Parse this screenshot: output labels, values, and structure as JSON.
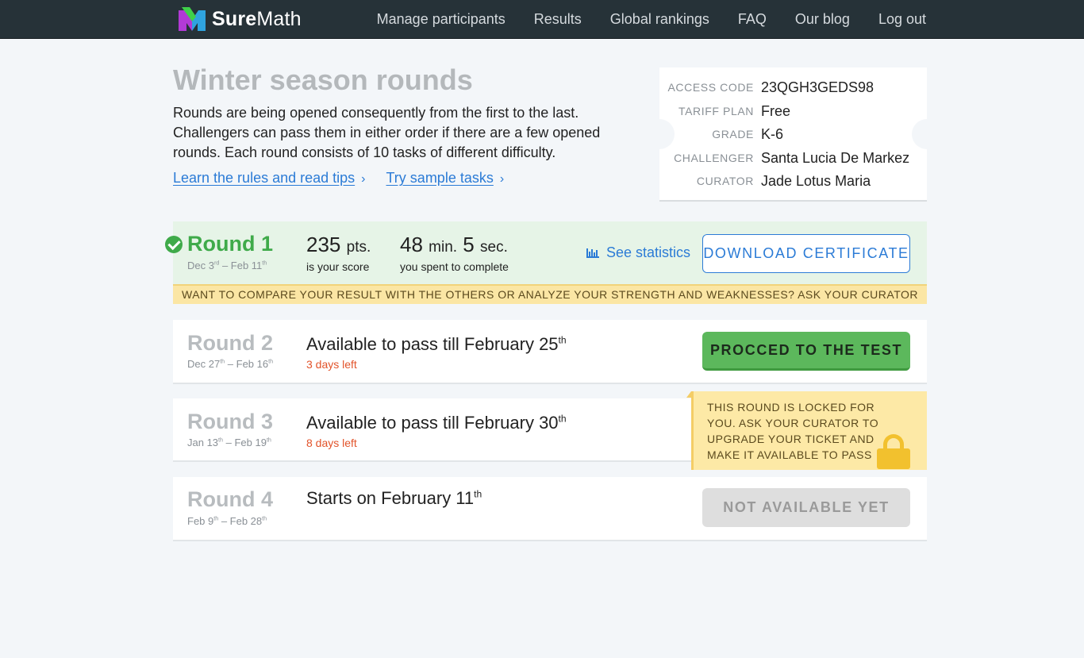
{
  "app": {
    "name_bold": "Sure",
    "name_rest": "Math"
  },
  "nav": [
    "Manage participants",
    "Results",
    "Global rankings",
    "FAQ",
    "Our blog",
    "Log out"
  ],
  "intro": {
    "title": "Winter season rounds",
    "text": "Rounds are being opened consequently from the first to the last. Challengers can pass them in either order if there are a few opened rounds. Each round consists of 10 tasks of different difficulty.",
    "link_rules": "Learn the rules and read tips",
    "link_samples": "Try sample tasks",
    "chevron": "›"
  },
  "ticket": [
    {
      "key": "ACCESS CODE",
      "value": "23QGH3GEDS98"
    },
    {
      "key": "TARIFF PLAN",
      "value": "Free"
    },
    {
      "key": "GRADE",
      "value": "K-6"
    },
    {
      "key": "CHALLENGER",
      "value": "Santa Lucia De Markez"
    },
    {
      "key": "CURATOR",
      "value": "Jade Lotus Maria"
    }
  ],
  "round1": {
    "title": "Round 1",
    "dates": [
      "Dec 3",
      "rd",
      " – Feb 11",
      "th"
    ],
    "score_value": "235",
    "score_unit": "pts.",
    "score_caption": "is your score",
    "time_min": "48",
    "time_min_unit": "min.",
    "time_sec": "5",
    "time_sec_unit": "sec.",
    "time_caption": "you spent to complete",
    "stats_link": "See statistics",
    "button": "DOWNLOAD CERTIFICATE",
    "banner": "WANT TO COMPARE YOUR RESULT WITH THE OTHERS OR ANALYZE YOUR STRENGTH AND WEAKNESSES? ASK YOUR CURATOR"
  },
  "round2": {
    "title": "Round 2",
    "dates": [
      "Dec 27",
      "th",
      " – Feb 16",
      "th"
    ],
    "avail": "Available to pass till February 25",
    "avail_sup": "th",
    "days_left": "3 days left",
    "button": "PROCCED TO THE TEST"
  },
  "round3": {
    "title": "Round 3",
    "dates": [
      "Jan 13",
      "th",
      " – Feb 19",
      "th"
    ],
    "avail": "Available to pass till February 30",
    "avail_sup": "th",
    "days_left": "8 days left",
    "locked_text": "THIS ROUND IS LOCKED FOR YOU. ASK YOUR CURATOR TO UPGRADE YOUR TICKET AND MAKE IT AVAILABLE TO PASS"
  },
  "round4": {
    "title": "Round 4",
    "dates": [
      "Feb 9",
      "th",
      " – Feb 28",
      "th"
    ],
    "starts": "Starts on February 11",
    "starts_sup": "th",
    "button": "NOT AVAILABLE YET"
  },
  "colors": {
    "header": "#263238",
    "accent": "#2b7bd6",
    "success": "#3faa4a",
    "warning_bg": "#fbe6a4",
    "danger_text": "#e2532a"
  },
  "icons": [
    "logo-icon",
    "check-circle-icon",
    "bar-chart-icon",
    "lock-icon",
    "chevron-right-icon"
  ]
}
